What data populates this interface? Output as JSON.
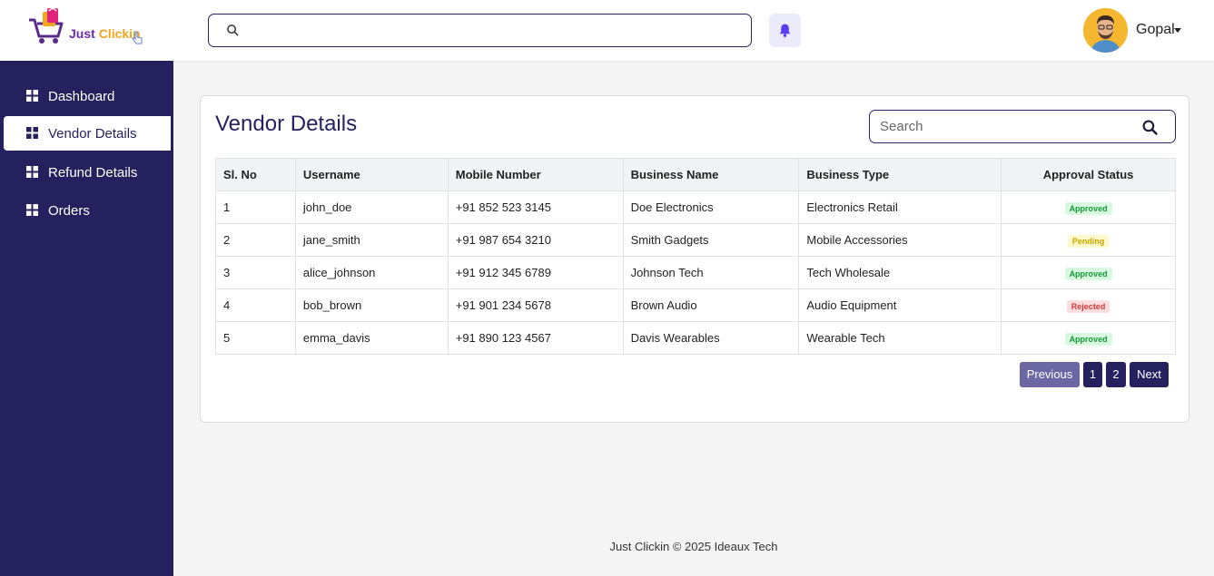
{
  "brand": {
    "logo_part1": "Just ",
    "logo_part2": "Clickin"
  },
  "header": {
    "search_placeholder": "",
    "user_name": "Gopal"
  },
  "sidebar": {
    "items": [
      {
        "label": "Dashboard",
        "icon": "grid-icon",
        "active": false
      },
      {
        "label": "Vendor Details",
        "icon": "grid-icon",
        "active": true
      },
      {
        "label": "Refund Details",
        "icon": "grid-icon",
        "active": false
      },
      {
        "label": "Orders",
        "icon": "grid-icon",
        "active": false
      }
    ]
  },
  "main": {
    "title": "Vendor Details",
    "search_placeholder": "Search",
    "table": {
      "columns": [
        "Sl. No",
        "Username",
        "Mobile Number",
        "Business Name",
        "Business Type",
        "Approval Status"
      ],
      "rows": [
        [
          "1",
          "john_doe",
          "+91 852 523 3145",
          "Doe Electronics",
          "Electronics Retail",
          "Approved"
        ],
        [
          "2",
          "jane_smith",
          "+91 987 654 3210",
          "Smith Gadgets",
          "Mobile Accessories",
          "Pending"
        ],
        [
          "3",
          "alice_johnson",
          "+91 912 345 6789",
          "Johnson Tech",
          "Tech Wholesale",
          "Approved"
        ],
        [
          "4",
          "bob_brown",
          "+91 901 234 5678",
          "Brown Audio",
          "Audio Equipment",
          "Rejected"
        ],
        [
          "5",
          "emma_davis",
          "+91 890 123 4567",
          "Davis Wearables",
          "Wearable Tech",
          "Approved"
        ]
      ]
    },
    "pagination": {
      "previous": "Previous",
      "pages": [
        "1",
        "2"
      ],
      "next": "Next"
    }
  },
  "footer": {
    "text": "Just Clickin © 2025 Ideaux Tech"
  },
  "colors": {
    "primary": "#24215e",
    "approved": "#149b36",
    "pending": "#c8a600",
    "rejected": "#d23b3b",
    "bell": "#5b3df5"
  }
}
